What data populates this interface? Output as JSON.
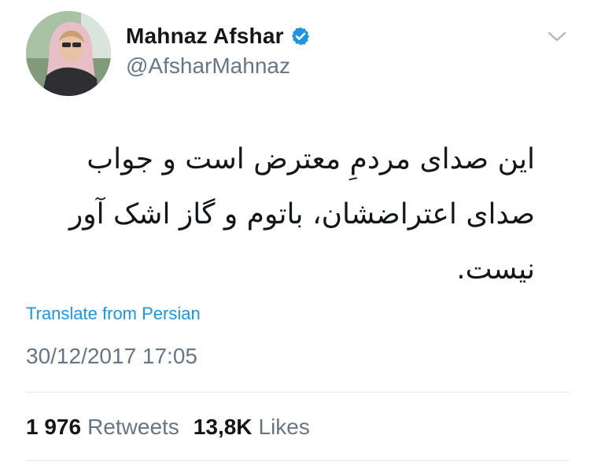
{
  "user": {
    "display_name": "Mahnaz Afshar",
    "handle": "@AfsharMahnaz",
    "verified": true,
    "avatar_icon": "profile-photo"
  },
  "tweet": {
    "text_lines": [
      "این صدای مردمِ معترض است و جواب",
      "صدای اعتراضشان، باتوم و گاز اشک آور",
      "نیست."
    ],
    "translate_label": "Translate from Persian",
    "timestamp": "30/12/2017 17:05"
  },
  "stats": {
    "retweets_count": "1 976",
    "retweets_label": "Retweets",
    "likes_count": "13,8K",
    "likes_label": "Likes"
  },
  "colors": {
    "accent": "#1d95e0",
    "muted": "#657786",
    "text": "#14171a",
    "divider": "#e1e8ed"
  },
  "icons": {
    "verified": "verified-badge-icon",
    "menu": "chevron-down-icon"
  }
}
